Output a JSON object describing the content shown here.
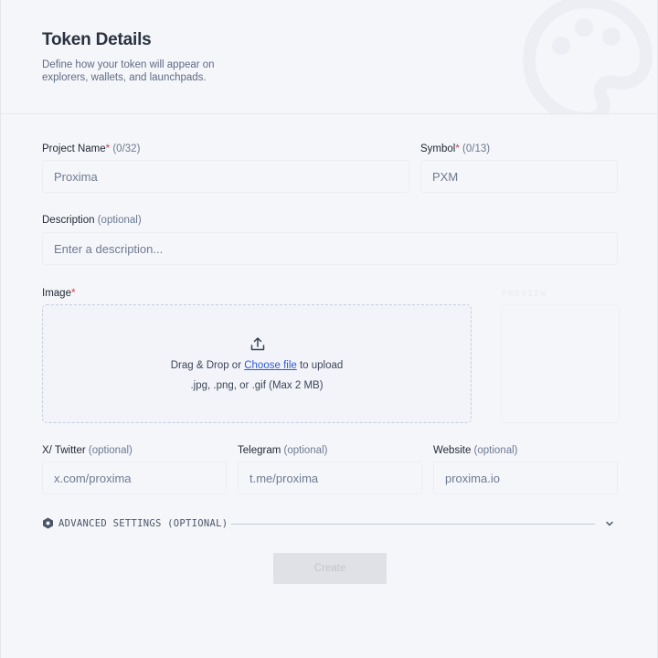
{
  "header": {
    "title": "Token Details",
    "subtitle": "Define how your token will appear on explorers, wallets, and launchpads."
  },
  "form": {
    "project_name": {
      "label": "Project Name",
      "required_mark": "*",
      "hint": " (0/32)",
      "value": "Proxima"
    },
    "symbol": {
      "label": "Symbol",
      "required_mark": "*",
      "hint": " (0/13)",
      "value": "PXM"
    },
    "description": {
      "label": "Description",
      "hint": " (optional)",
      "placeholder": "Enter a description..."
    },
    "image": {
      "label": "Image",
      "required_mark": "*",
      "drop_text_before": "Drag & Drop or ",
      "choose_file": "Choose file",
      "drop_text_after": " to upload",
      "formats": ".jpg, .png, or .gif (Max 2 MB)",
      "upload_icon": "upload-icon"
    },
    "preview_label": "PREVIEW",
    "twitter": {
      "label": "X/ Twitter",
      "hint": " (optional)",
      "placeholder": "x.com/proxima"
    },
    "telegram": {
      "label": "Telegram",
      "hint": " (optional)",
      "placeholder": "t.me/proxima"
    },
    "website": {
      "label": "Website",
      "hint": " (optional)",
      "placeholder": "proxima.io"
    }
  },
  "advanced": {
    "label": "ADVANCED SETTINGS (OPTIONAL)",
    "icon": "hexagon-icon",
    "chevron": "chevron-down-icon"
  },
  "create_button": "Create",
  "colors": {
    "accent": "#2f5bd3",
    "required": "#e0364f",
    "button_disabled": "#dfe1e6"
  }
}
